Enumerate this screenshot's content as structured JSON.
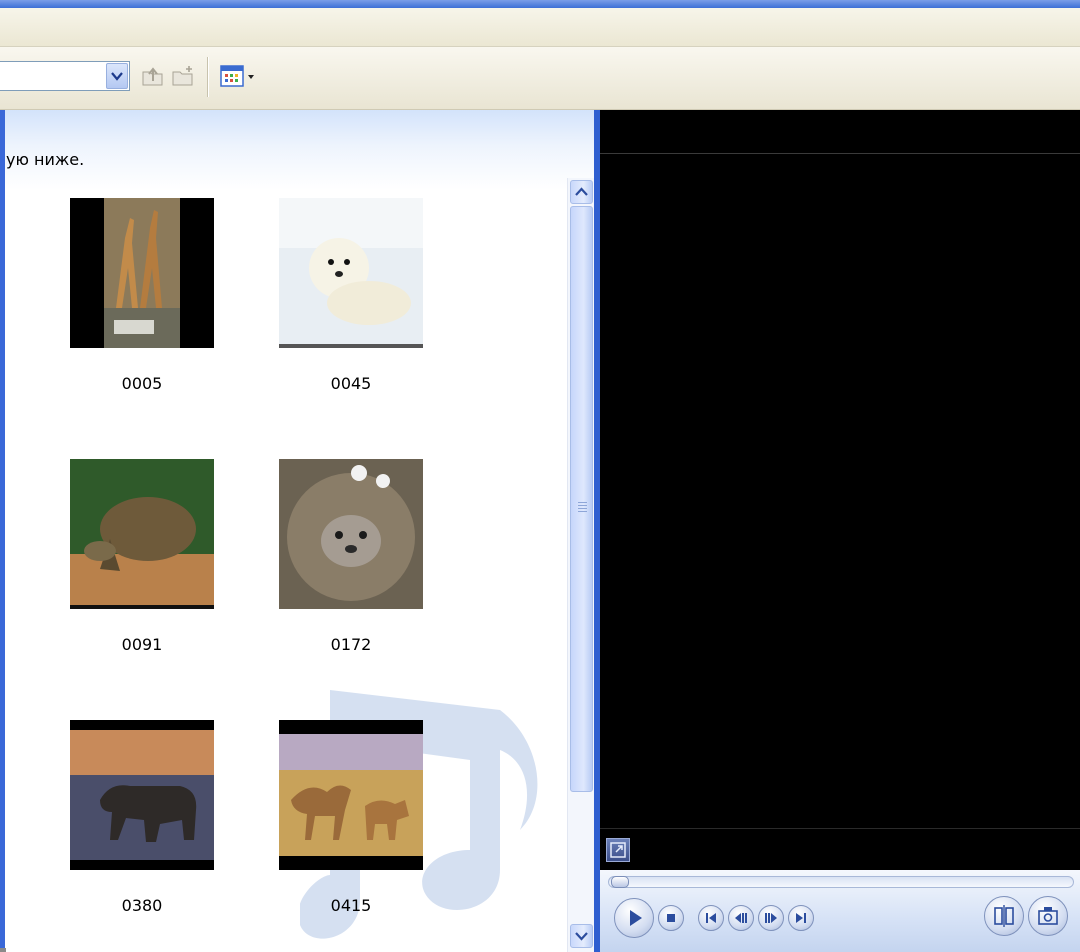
{
  "content": {
    "hint_text": "ую ниже.",
    "clips": [
      {
        "label": "0005"
      },
      {
        "label": "0045"
      },
      {
        "label": "0091"
      },
      {
        "label": "0172"
      },
      {
        "label": "0380"
      },
      {
        "label": "0415"
      }
    ]
  },
  "icons": {
    "path_dropdown": "chevron-down-icon",
    "up_folder": "up-folder-icon",
    "new_folder": "new-folder-icon",
    "views": "views-icon",
    "fullscreen": "fullscreen-icon",
    "play": "play-icon",
    "stop": "stop-icon",
    "prev": "previous-icon",
    "back_frame": "back-frame-icon",
    "next_frame": "next-frame-icon",
    "next": "next-icon",
    "split": "split-clip-icon",
    "snapshot": "snapshot-icon"
  },
  "colors": {
    "accent": "#2f5fd0",
    "preview_background": "#000000"
  }
}
